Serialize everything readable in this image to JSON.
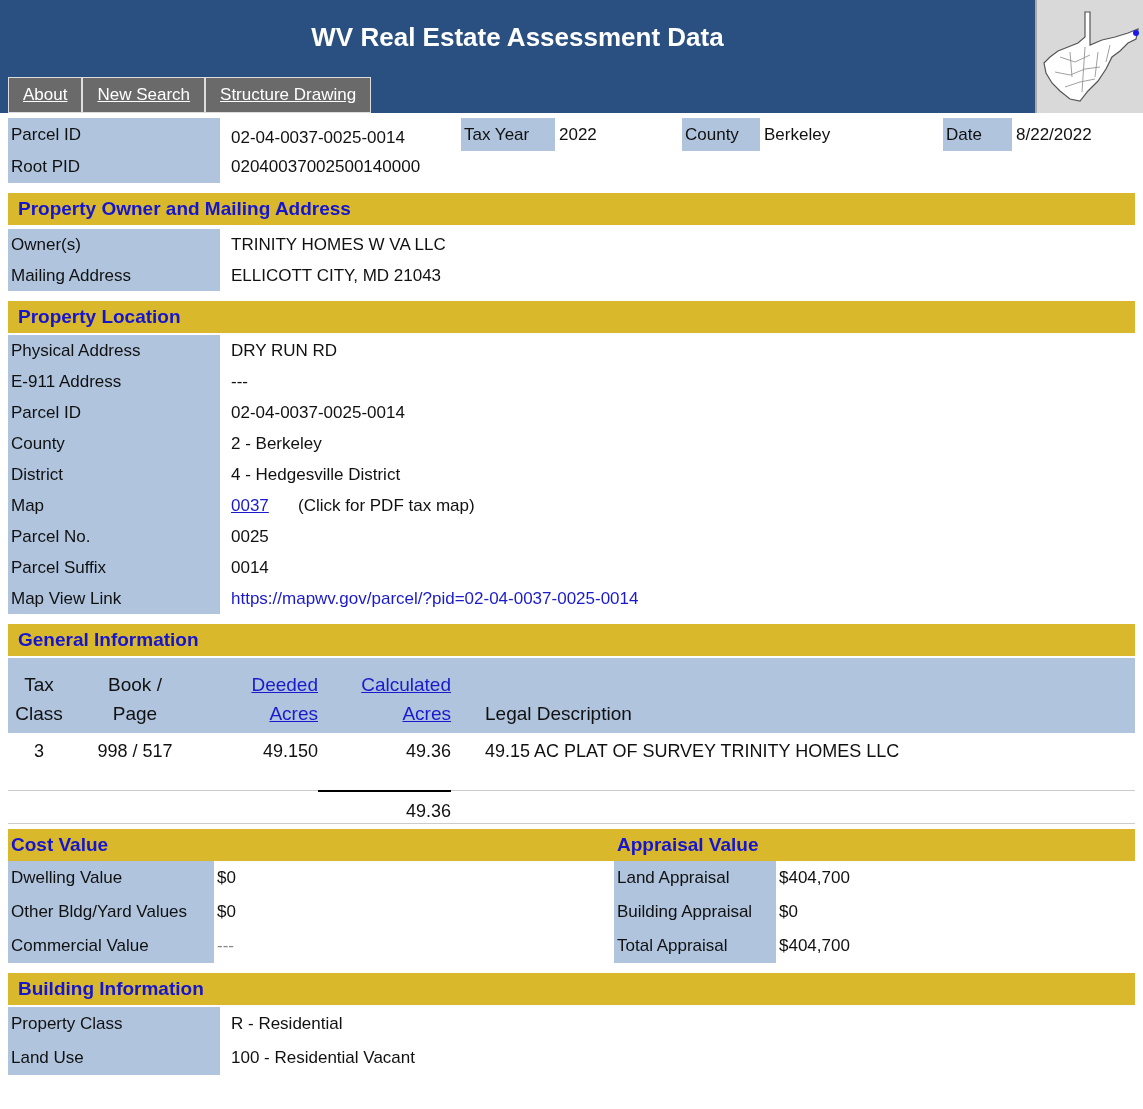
{
  "header": {
    "title": "WV Real Estate Assessment Data",
    "tabs": [
      {
        "label": "About"
      },
      {
        "label": "New Search"
      },
      {
        "label": "Structure Drawing"
      }
    ]
  },
  "summary": {
    "first_row": [
      {
        "label": "Parcel ID",
        "value": "02-04-0037-0025-0014"
      },
      {
        "label": "Tax Year",
        "value": "2022"
      },
      {
        "label": "County",
        "value": "Berkeley"
      },
      {
        "label": "Date",
        "value": "8/22/2022"
      }
    ],
    "second_row": {
      "label": "Root PID",
      "value": "02040037002500140000"
    }
  },
  "owner": {
    "title": "Property Owner and Mailing Address",
    "rows": [
      {
        "label": "Owner(s)",
        "value": "TRINITY HOMES W VA LLC"
      },
      {
        "label": "Mailing Address",
        "value": "ELLICOTT CITY, MD 21043"
      }
    ]
  },
  "location": {
    "title": "Property Location",
    "rows": [
      {
        "kind": "text",
        "label": "Physical Address",
        "value": "DRY RUN RD"
      },
      {
        "kind": "text",
        "label": "E-911 Address",
        "value": "---"
      },
      {
        "kind": "text",
        "label": "Parcel ID",
        "value": "02-04-0037-0025-0014"
      },
      {
        "kind": "text",
        "label": "County",
        "value": "2 - Berkeley"
      },
      {
        "kind": "text",
        "label": "District",
        "value": "4 - Hedgesville District"
      },
      {
        "kind": "map",
        "label": "Map",
        "value": "0037",
        "note": "(Click for PDF tax map)"
      },
      {
        "kind": "text",
        "label": "Parcel No.",
        "value": "0025"
      },
      {
        "kind": "text",
        "label": "Parcel Suffix",
        "value": "0014"
      },
      {
        "kind": "link",
        "label": "Map View Link",
        "value": "https://mapwv.gov/parcel/?pid=02-04-0037-0025-0014"
      }
    ]
  },
  "general": {
    "title": "General Information",
    "columns": [
      {
        "kind": "text",
        "lines": [
          "Tax",
          "Class"
        ]
      },
      {
        "kind": "text",
        "lines": [
          "Book /",
          "Page"
        ]
      },
      {
        "kind": "link",
        "lines": [
          "Deeded",
          "Acres"
        ]
      },
      {
        "kind": "link",
        "lines": [
          "Calculated",
          "Acres"
        ]
      },
      {
        "kind": "text",
        "lines": [
          "Legal Description"
        ]
      }
    ],
    "rows": [
      [
        "3",
        "998 / 517",
        "49.150",
        "49.36",
        "49.15 AC PLAT OF SURVEY TRINITY HOMES LLC"
      ]
    ],
    "total": "49.36"
  },
  "cost": {
    "title": "Cost Value",
    "rows": [
      {
        "label": "Dwelling Value",
        "value": "$0",
        "disabled": false
      },
      {
        "label": "Other Bldg/Yard Values",
        "value": "$0",
        "disabled": false
      },
      {
        "label": "Commercial Value",
        "value": "---",
        "disabled": true
      }
    ]
  },
  "appraisal": {
    "title": "Appraisal Value",
    "rows": [
      {
        "label": "Land Appraisal",
        "value": "$404,700",
        "disabled": false
      },
      {
        "label": "Building Appraisal",
        "value": "$0",
        "disabled": false
      },
      {
        "label": "Total Appraisal",
        "value": "$404,700",
        "disabled": false
      }
    ]
  },
  "building": {
    "title": "Building Information",
    "rows": [
      {
        "label": "Property Class",
        "value": "R - Residential"
      },
      {
        "label": "Land Use",
        "value": "100 - Residential Vacant"
      }
    ]
  }
}
